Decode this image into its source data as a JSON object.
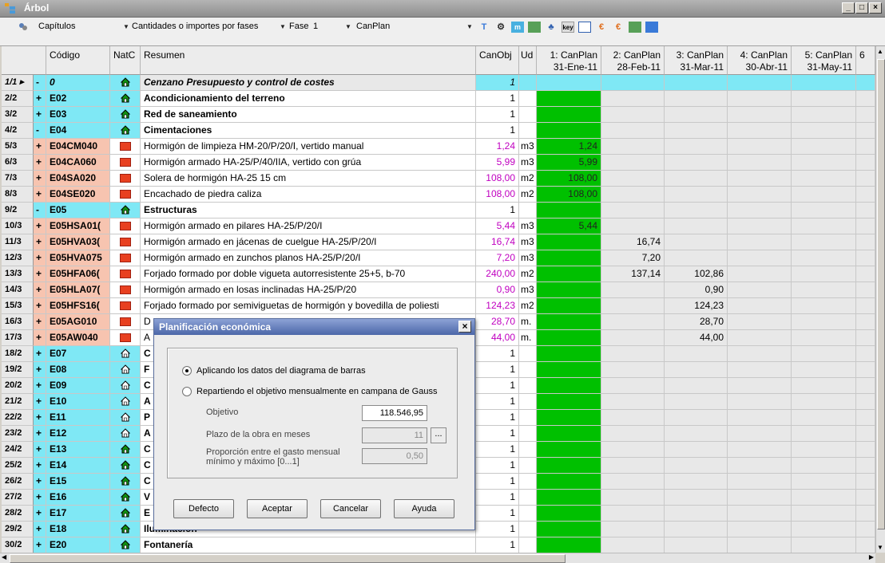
{
  "window": {
    "title": "Árbol",
    "buttons": [
      "_",
      "□",
      "×"
    ]
  },
  "toolbar": {
    "level_label": "Capítulos",
    "mode_label": "Cantidades o importes por fases",
    "fase_label": "Fase",
    "fase_value": "1",
    "plan_label": "CanPlan",
    "icons": [
      "sort-t-icon",
      "gear-icon",
      "calendar-icon",
      "chart-icon",
      "tree-icon",
      "key-icon",
      "window-icon",
      "euro-icon",
      "euro-bar-icon",
      "table-icon",
      "grid-icon"
    ]
  },
  "columns": {
    "code": "Código",
    "natc": "NatC",
    "resumen": "Resumen",
    "canobj": "CanObj",
    "ud": "Ud",
    "months": [
      {
        "l1": "1: CanPlan",
        "l2": "31-Ene-11"
      },
      {
        "l1": "2: CanPlan",
        "l2": "28-Feb-11"
      },
      {
        "l1": "3: CanPlan",
        "l2": "31-Mar-11"
      },
      {
        "l1": "4: CanPlan",
        "l2": "30-Abr-11"
      },
      {
        "l1": "5: CanPlan",
        "l2": "31-May-11"
      },
      {
        "l1": "6",
        "l2": ""
      }
    ]
  },
  "rows": [
    {
      "id": "1/1 ▸",
      "pm": "-",
      "code": "0",
      "nat": "house",
      "res": "Cenzano Presupuesto y control de costes",
      "can": "1",
      "ud": "",
      "m1": "",
      "m2": "",
      "m3": "",
      "type": "root"
    },
    {
      "id": "2/2",
      "pm": "+",
      "code": "E02",
      "nat": "house",
      "res": "Acondicionamiento del terreno",
      "can": "1",
      "ud": "",
      "m1": "",
      "m2": "",
      "m3": "",
      "type": "chapter"
    },
    {
      "id": "3/2",
      "pm": "+",
      "code": "E03",
      "nat": "house",
      "res": "Red de saneamiento",
      "can": "1",
      "ud": "",
      "m1": "",
      "m2": "",
      "m3": "",
      "type": "chapter"
    },
    {
      "id": "4/2",
      "pm": "-",
      "code": "E04",
      "nat": "house",
      "res": "Cimentaciones",
      "can": "1",
      "ud": "",
      "m1": "",
      "m2": "",
      "m3": "",
      "type": "chapter"
    },
    {
      "id": "5/3",
      "pm": "+",
      "code": "E04CM040",
      "nat": "mat",
      "res": "Hormigón de limpieza HM-20/P/20/I, vertido manual",
      "can": "1,24",
      "ud": "m3",
      "m1": "1,24",
      "m2": "",
      "m3": "",
      "type": "item"
    },
    {
      "id": "6/3",
      "pm": "+",
      "code": "E04CA060",
      "nat": "mat",
      "res": "Hormigón armado HA-25/P/40/IIA, vertido con grúa",
      "can": "5,99",
      "ud": "m3",
      "m1": "5,99",
      "m2": "",
      "m3": "",
      "type": "item"
    },
    {
      "id": "7/3",
      "pm": "+",
      "code": "E04SA020",
      "nat": "mat",
      "res": "Solera de hormigón HA-25 15 cm",
      "can": "108,00",
      "ud": "m2",
      "m1": "108,00",
      "m2": "",
      "m3": "",
      "type": "item"
    },
    {
      "id": "8/3",
      "pm": "+",
      "code": "E04SE020",
      "nat": "mat",
      "res": "Encachado de piedra caliza",
      "can": "108,00",
      "ud": "m2",
      "m1": "108,00",
      "m2": "",
      "m3": "",
      "type": "item"
    },
    {
      "id": "9/2",
      "pm": "-",
      "code": "E05",
      "nat": "house",
      "res": "Estructuras",
      "can": "1",
      "ud": "",
      "m1": "",
      "m2": "",
      "m3": "",
      "type": "chapter"
    },
    {
      "id": "10/3",
      "pm": "+",
      "code": "E05HSA01(",
      "nat": "mat",
      "res": "Hormigón armado en pilares HA-25/P/20/I",
      "can": "5,44",
      "ud": "m3",
      "m1": "5,44",
      "m2": "",
      "m3": "",
      "type": "item"
    },
    {
      "id": "11/3",
      "pm": "+",
      "code": "E05HVA03(",
      "nat": "mat",
      "res": "Hormigón armado en jácenas de cuelgue HA-25/P/20/I",
      "can": "16,74",
      "ud": "m3",
      "m1": "",
      "m2": "16,74",
      "m3": "",
      "type": "item"
    },
    {
      "id": "12/3",
      "pm": "+",
      "code": "E05HVA075",
      "nat": "mat",
      "res": "Hormigón armado en zunchos planos HA-25/P/20/I",
      "can": "7,20",
      "ud": "m3",
      "m1": "",
      "m2": "7,20",
      "m3": "",
      "type": "item"
    },
    {
      "id": "13/3",
      "pm": "+",
      "code": "E05HFA06(",
      "nat": "mat",
      "res": "Forjado formado por doble vigueta autorresistente 25+5, b-70",
      "can": "240,00",
      "ud": "m2",
      "m1": "",
      "m2": "137,14",
      "m3": "102,86",
      "type": "item"
    },
    {
      "id": "14/3",
      "pm": "+",
      "code": "E05HLA07(",
      "nat": "mat",
      "res": "Hormigón armado en losas inclinadas HA-25/P/20",
      "can": "0,90",
      "ud": "m3",
      "m1": "",
      "m2": "",
      "m3": "0,90",
      "type": "item"
    },
    {
      "id": "15/3",
      "pm": "+",
      "code": "E05HFS16(",
      "nat": "mat",
      "res": "Forjado formado por semiviguetas de hormigón y bovedilla de poliesti",
      "can": "124,23",
      "ud": "m2",
      "m1": "",
      "m2": "",
      "m3": "124,23",
      "type": "item"
    },
    {
      "id": "16/3",
      "pm": "+",
      "code": "E05AG010",
      "nat": "mat",
      "res": "D",
      "can": "28,70",
      "ud": "m.",
      "m1": "",
      "m2": "",
      "m3": "28,70",
      "type": "item"
    },
    {
      "id": "17/3",
      "pm": "+",
      "code": "E05AW040",
      "nat": "mat",
      "res": "A",
      "can": "44,00",
      "ud": "m.",
      "m1": "",
      "m2": "",
      "m3": "44,00",
      "type": "item"
    },
    {
      "id": "18/2",
      "pm": "+",
      "code": "E07",
      "nat": "house-w",
      "res": "C",
      "can": "1",
      "ud": "",
      "m1": "",
      "m2": "",
      "m3": "",
      "type": "chapter"
    },
    {
      "id": "19/2",
      "pm": "+",
      "code": "E08",
      "nat": "house-w",
      "res": "F",
      "can": "1",
      "ud": "",
      "m1": "",
      "m2": "",
      "m3": "",
      "type": "chapter"
    },
    {
      "id": "20/2",
      "pm": "+",
      "code": "E09",
      "nat": "house-w",
      "res": "C",
      "can": "1",
      "ud": "",
      "m1": "",
      "m2": "",
      "m3": "",
      "type": "chapter"
    },
    {
      "id": "21/2",
      "pm": "+",
      "code": "E10",
      "nat": "house-w",
      "res": "A",
      "can": "1",
      "ud": "",
      "m1": "",
      "m2": "",
      "m3": "",
      "type": "chapter"
    },
    {
      "id": "22/2",
      "pm": "+",
      "code": "E11",
      "nat": "house-w",
      "res": "P",
      "can": "1",
      "ud": "",
      "m1": "",
      "m2": "",
      "m3": "",
      "type": "chapter"
    },
    {
      "id": "23/2",
      "pm": "+",
      "code": "E12",
      "nat": "house-w",
      "res": "A",
      "can": "1",
      "ud": "",
      "m1": "",
      "m2": "",
      "m3": "",
      "type": "chapter"
    },
    {
      "id": "24/2",
      "pm": "+",
      "code": "E13",
      "nat": "house",
      "res": "C",
      "can": "1",
      "ud": "",
      "m1": "",
      "m2": "",
      "m3": "",
      "type": "chapter"
    },
    {
      "id": "25/2",
      "pm": "+",
      "code": "E14",
      "nat": "house",
      "res": "C",
      "can": "1",
      "ud": "",
      "m1": "",
      "m2": "",
      "m3": "",
      "type": "chapter"
    },
    {
      "id": "26/2",
      "pm": "+",
      "code": "E15",
      "nat": "house",
      "res": "C",
      "can": "1",
      "ud": "",
      "m1": "",
      "m2": "",
      "m3": "",
      "type": "chapter"
    },
    {
      "id": "27/2",
      "pm": "+",
      "code": "E16",
      "nat": "house",
      "res": "V",
      "can": "1",
      "ud": "",
      "m1": "",
      "m2": "",
      "m3": "",
      "type": "chapter"
    },
    {
      "id": "28/2",
      "pm": "+",
      "code": "E17",
      "nat": "house",
      "res": "E",
      "can": "1",
      "ud": "",
      "m1": "",
      "m2": "",
      "m3": "",
      "type": "chapter"
    },
    {
      "id": "29/2",
      "pm": "+",
      "code": "E18",
      "nat": "house",
      "res": "Iluminación",
      "can": "1",
      "ud": "",
      "m1": "",
      "m2": "",
      "m3": "",
      "type": "chapter"
    },
    {
      "id": "30/2",
      "pm": "+",
      "code": "E20",
      "nat": "house",
      "res": "Fontanería",
      "can": "1",
      "ud": "",
      "m1": "",
      "m2": "",
      "m3": "",
      "type": "chapter"
    }
  ],
  "dialog": {
    "title": "Planificación económica",
    "radio1": "Aplicando los datos del diagrama de barras",
    "radio2": "Repartiendo el objetivo mensualmente en campana de Gauss",
    "objetivo_label": "Objetivo",
    "objetivo_value": "118.546,95",
    "plazo_label": "Plazo de la obra en meses",
    "plazo_value": "11",
    "plazo_btn": "...",
    "prop_label_1": "Proporción entre el gasto mensual",
    "prop_label_2": "mínimo y máximo [0...1]",
    "prop_value": "0,50",
    "btn_defecto": "Defecto",
    "btn_aceptar": "Aceptar",
    "btn_cancelar": "Cancelar",
    "btn_ayuda": "Ayuda",
    "close": "×"
  }
}
